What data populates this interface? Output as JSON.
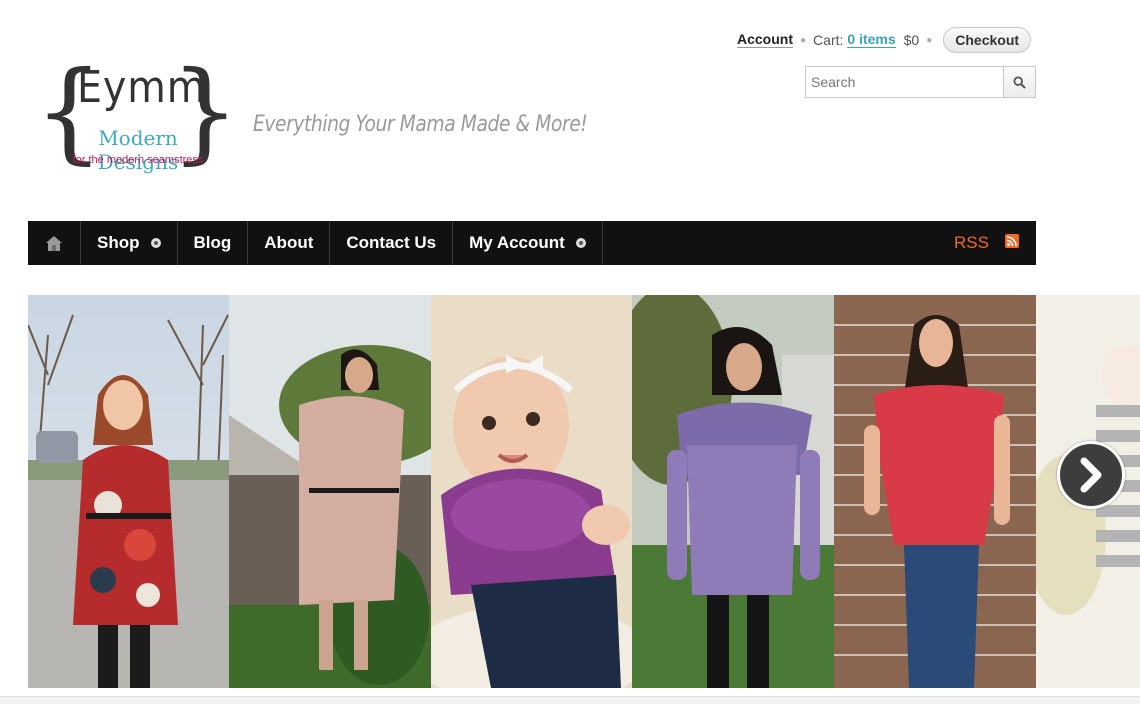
{
  "header": {
    "account_label": "Account",
    "cart_label": "Cart:",
    "cart_items": "0 items",
    "cart_total": "$0",
    "checkout_label": "Checkout",
    "search_placeholder": "Search"
  },
  "logo": {
    "title": "Eymm",
    "subtitle": "Modern Designs",
    "caption": "for the modern seamstress",
    "tagline": "Everything Your Mama Made & More!"
  },
  "nav": {
    "items": [
      {
        "label": "Shop",
        "dropdown": true
      },
      {
        "label": "Blog",
        "dropdown": false
      },
      {
        "label": "About",
        "dropdown": false
      },
      {
        "label": "Contact Us",
        "dropdown": false
      },
      {
        "label": "My Account",
        "dropdown": true
      }
    ],
    "rss_label": "RSS"
  },
  "slider": {
    "slides": [
      {
        "subject": "girl-patterned-dress"
      },
      {
        "subject": "woman-pink-dress"
      },
      {
        "subject": "baby-purple-cowl"
      },
      {
        "subject": "woman-purple-cowl-top"
      },
      {
        "subject": "woman-red-top"
      },
      {
        "subject": "child-striped-shirt"
      }
    ]
  },
  "colors": {
    "nav_bg": "#111111",
    "accent_teal": "#3aa3b5",
    "rss_orange": "#ef6a25",
    "logo_pink": "#c2185b"
  },
  "icons": [
    "home-icon",
    "dropdown-dot-icon",
    "rss-icon",
    "search-icon",
    "chevron-right-icon"
  ]
}
